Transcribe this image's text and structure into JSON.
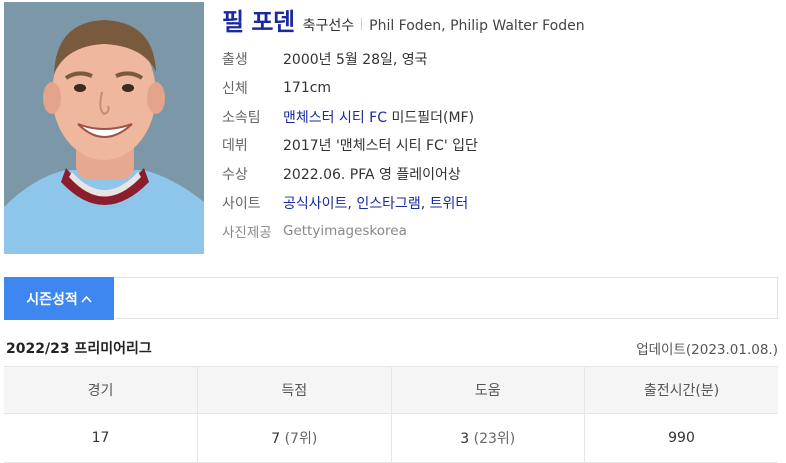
{
  "profile": {
    "name": "필 포덴",
    "role": "축구선수",
    "english_name": "Phil Foden, Philip Walter Foden",
    "photo_icon": "player-photo",
    "info": [
      {
        "label": "출생",
        "value": "2000년 5월 28일, 영국"
      },
      {
        "label": "신체",
        "value": "171cm"
      },
      {
        "label": "소속팀",
        "team_link": "맨체스터 시티 FC",
        "value": " 미드필더(MF)"
      },
      {
        "label": "데뷔",
        "value": "2017년 '맨체스터 시티 FC' 입단"
      },
      {
        "label": "수상",
        "value": "2022.06. PFA 영 플레이어상"
      },
      {
        "label": "사이트",
        "links": [
          "공식사이트",
          "인스타그램",
          "트위터"
        ],
        "separator": ", "
      },
      {
        "label": "사진제공",
        "value": "Gettyimageskorea"
      }
    ]
  },
  "tabs": {
    "active_label": "시즌성적",
    "active_icon": "chevron-up-icon",
    "active_color": "#3e86f0"
  },
  "season": {
    "title": "2022/23 프리미어리그",
    "updated": "업데이트(2023.01.08.)"
  },
  "stats_table": {
    "headers": [
      "경기",
      "득점",
      "도움",
      "출전시간(분)"
    ],
    "row": {
      "games": "17",
      "goals": "7",
      "goals_rank": "(7위)",
      "assists": "3",
      "assists_rank": "(23위)",
      "minutes": "990"
    }
  }
}
